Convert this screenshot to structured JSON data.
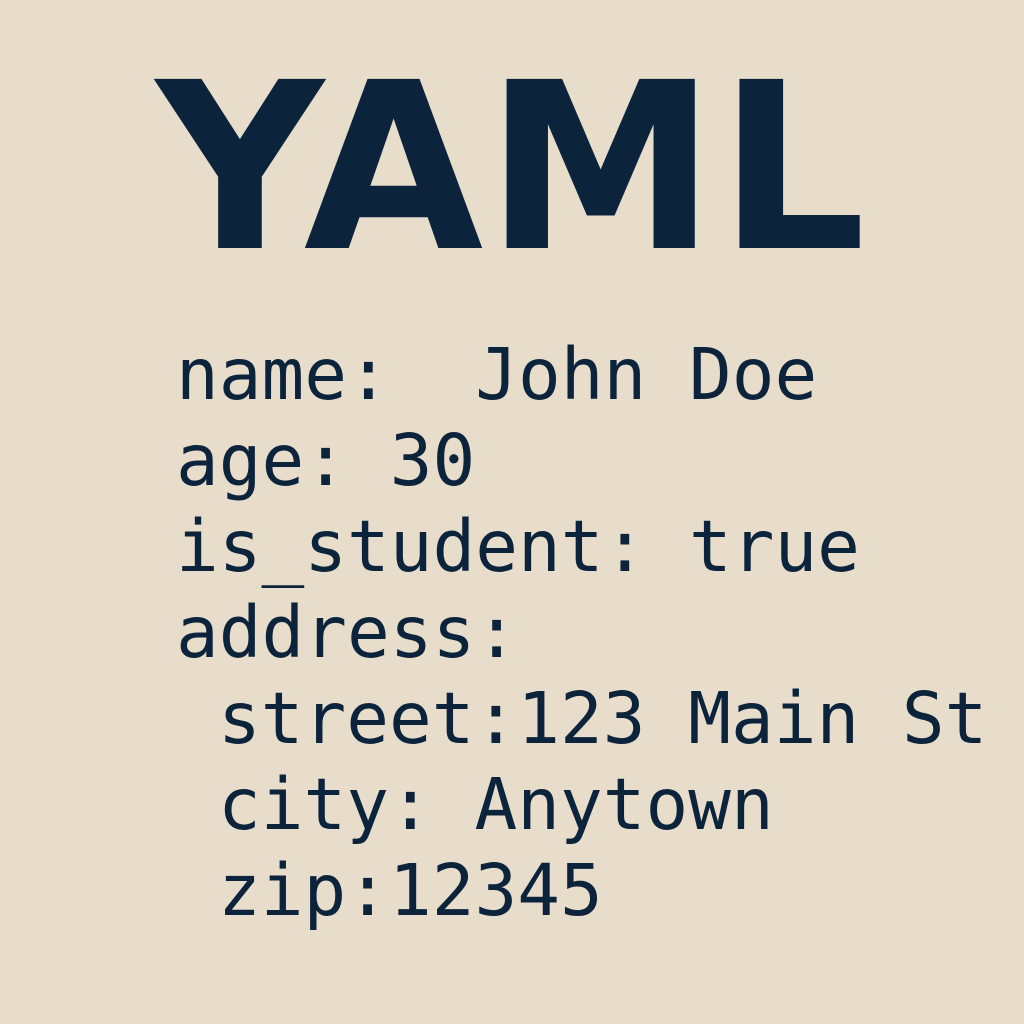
{
  "title": "YAML",
  "colors": {
    "background": "#e8dccb",
    "text": "#0b243c"
  },
  "lines": [
    {
      "text": "name:  John Doe",
      "indent": 0
    },
    {
      "text": "age: 30",
      "indent": 0
    },
    {
      "text": "is_student: true",
      "indent": 0
    },
    {
      "text": "address:",
      "indent": 0
    },
    {
      "text": "street:123 Main St",
      "indent": 1
    },
    {
      "text": "city: Anytown",
      "indent": 1
    },
    {
      "text": "zip:12345",
      "indent": 1
    }
  ]
}
